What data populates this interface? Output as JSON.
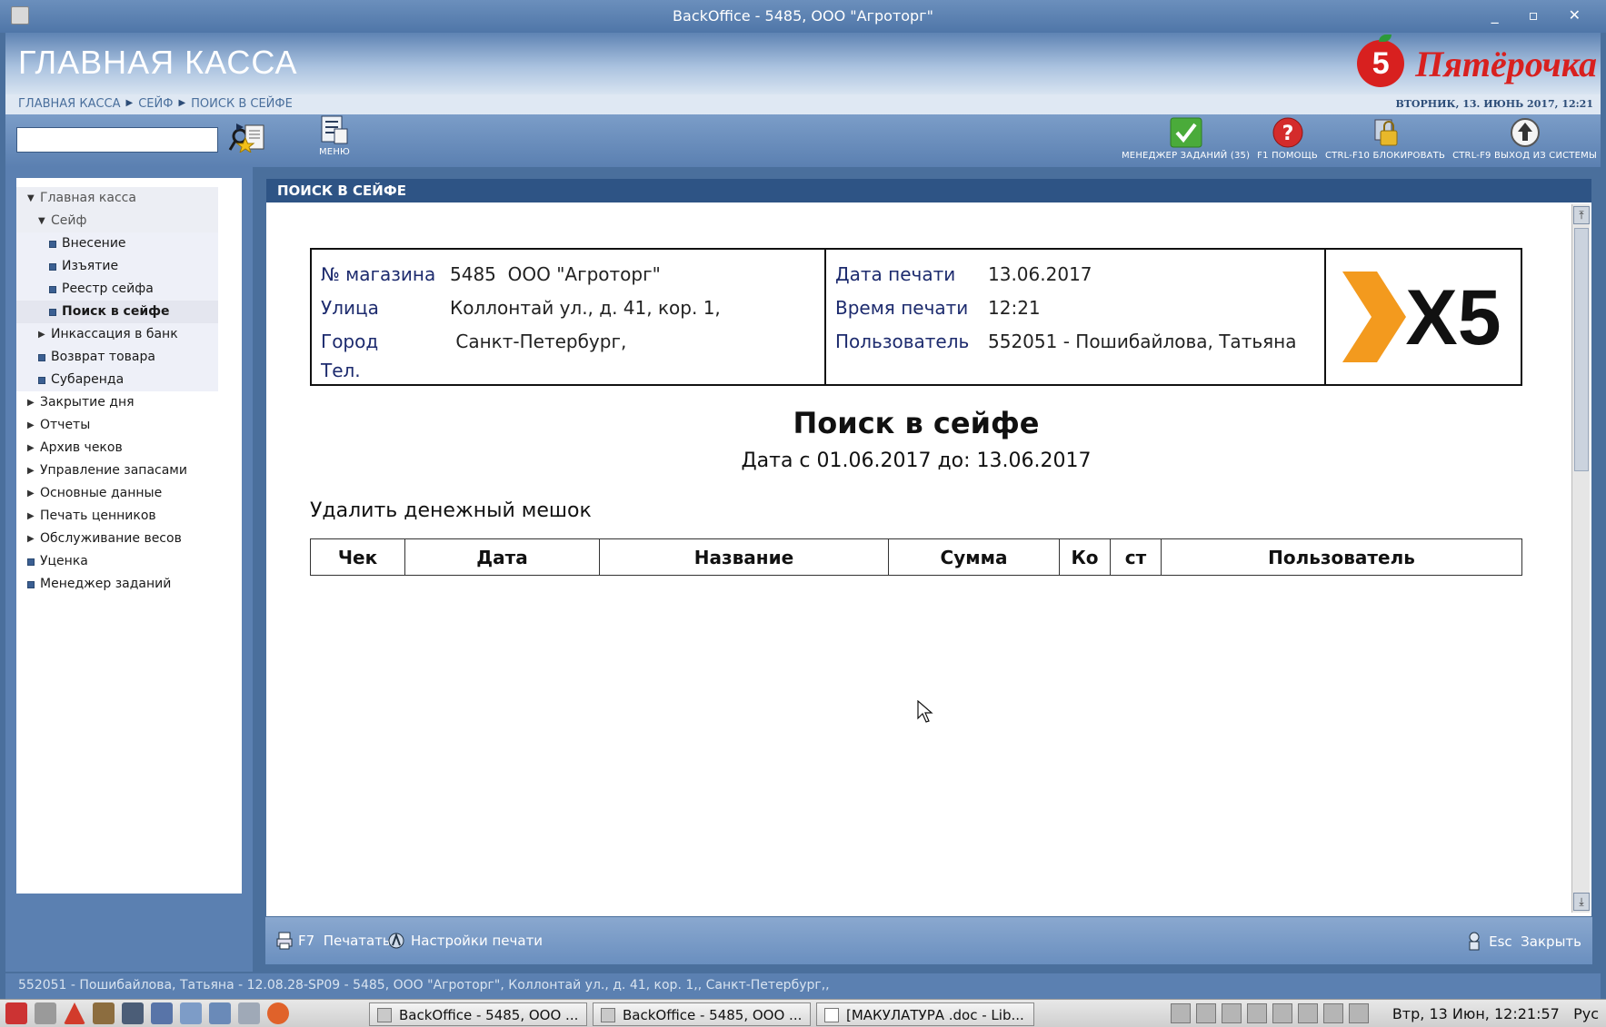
{
  "window": {
    "title": "BackOffice - 5485, ООО \"Агроторг\"",
    "controls": "_ ▫ ✕"
  },
  "header": {
    "app_title": "ГЛАВНАЯ КАССА",
    "brand_name": "Пятёрочка",
    "brand_mark": "5",
    "brand_color": "#d8201f"
  },
  "breadcrumb": {
    "items": [
      "ГЛАВНАЯ КАССА",
      "СЕЙФ",
      "ПОИСК В СЕЙФЕ"
    ],
    "separator": "▶",
    "datetime": "ВТОРНИК, 13. ИЮНЬ 2017, 12:21"
  },
  "toolbar": {
    "search": {
      "value": "",
      "placeholder": ""
    },
    "menu_label": "МЕНЮ",
    "right_buttons": [
      {
        "label": "МЕНЕДЖЕР ЗАДАНИЙ (35)",
        "icon": "checkmark-icon"
      },
      {
        "label": "F1 ПОМОЩЬ",
        "icon": "help-icon"
      },
      {
        "label": "CTRL-F10 БЛОКИРОВАТЬ",
        "icon": "lock-icon"
      },
      {
        "label": "CTRL-F9 ВЫХОД ИЗ СИСТЕМЫ",
        "icon": "exit-icon"
      }
    ]
  },
  "sidebar": {
    "items": [
      {
        "label": "Главная касса",
        "level": 0,
        "icon": "arrow-down"
      },
      {
        "label": "Сейф",
        "level": 1,
        "icon": "arrow-down"
      },
      {
        "label": "Внесение",
        "level": 2,
        "icon": "square"
      },
      {
        "label": "Изъятие",
        "level": 2,
        "icon": "square"
      },
      {
        "label": "Реестр сейфа",
        "level": 2,
        "icon": "square"
      },
      {
        "label": "Поиск в сейфе",
        "level": 2,
        "icon": "square",
        "active": true
      },
      {
        "label": "Инкассация в банк",
        "level": 1,
        "icon": "arrow-right"
      },
      {
        "label": "Возврат товара",
        "level": 1,
        "icon": "square"
      },
      {
        "label": "Субаренда",
        "level": 1,
        "icon": "square"
      },
      {
        "label": "Закрытие дня",
        "level": 0,
        "icon": "arrow-right"
      },
      {
        "label": "Отчеты",
        "level": 0,
        "icon": "arrow-right"
      },
      {
        "label": "Архив чеков",
        "level": 0,
        "icon": "arrow-right"
      },
      {
        "label": "Управление запасами",
        "level": 0,
        "icon": "arrow-right"
      },
      {
        "label": "Основные данные",
        "level": 0,
        "icon": "arrow-right"
      },
      {
        "label": "Печать ценников",
        "level": 0,
        "icon": "arrow-right"
      },
      {
        "label": "Обслуживание весов",
        "level": 0,
        "icon": "arrow-right"
      },
      {
        "label": "Уценка",
        "level": 0,
        "icon": "square"
      },
      {
        "label": "Менеджер заданий",
        "level": 0,
        "icon": "square"
      }
    ]
  },
  "panel": {
    "title": "ПОИСК В СЕЙФЕ"
  },
  "report": {
    "store_info": [
      {
        "key": "№ магазина",
        "value": "5485  ООО \"Агроторг\""
      },
      {
        "key": "Улица",
        "value": "Коллонтай ул., д. 41, кор. 1,"
      },
      {
        "key": "Город",
        "value": " Санкт-Петербург,"
      },
      {
        "key": "Тел.",
        "value": ""
      }
    ],
    "print_info": [
      {
        "key": "Дата печати",
        "value": "13.06.2017"
      },
      {
        "key": "Время печати",
        "value": "12:21"
      },
      {
        "key": "Пользователь",
        "value": "552051 - Пошибайлова, Татьяна"
      }
    ],
    "logo_text": "X5",
    "title": "Поиск в сейфе",
    "subtitle": "Дата с 01.06.2017 до: 13.06.2017",
    "section_label": "Удалить денежный мешок",
    "table_headers": [
      "Чек",
      "Дата",
      "Название",
      "Сумма",
      "Ко",
      "ст",
      "Пользователь"
    ]
  },
  "bottombar": {
    "print": "F7  Печатать",
    "print_settings": "Настройки печати",
    "close": "Esc  Закрыть"
  },
  "statusbar": {
    "text": "552051 - Пошибайлова, Татьяна - 12.08.28-SP09 - 5485, ООО \"Агроторг\", Коллонтай ул., д. 41, кор. 1,, Санкт-Петербург,,"
  },
  "taskbar": {
    "tasks": [
      "BackOffice - 5485, ООО ...",
      "BackOffice - 5485, ООО ...",
      "[МАКУЛАТУРА .doc - Lib..."
    ],
    "clock": "Втр, 13 Июн, 12:21:57",
    "lang": "Рус"
  }
}
